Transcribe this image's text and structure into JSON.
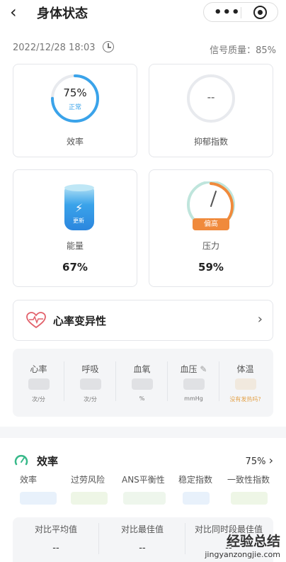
{
  "header": {
    "back_icon": "back-arrow-icon",
    "title": "身体状态",
    "more_icon": "more-dots-icon",
    "target_icon": "target-icon"
  },
  "meta": {
    "datetime": "2022/12/28 18:03",
    "clock_icon": "clock-icon",
    "signal": "信号质量：85%"
  },
  "cards": {
    "efficiency": {
      "value": "75%",
      "status": "正常",
      "label": "效率",
      "progress": 0.75,
      "color": "#3aa3ea"
    },
    "depression": {
      "value": "--",
      "label": "抑郁指数"
    },
    "energy": {
      "badge": "更新",
      "label": "能量",
      "value": "67%",
      "icon": "battery-icon"
    },
    "pressure": {
      "badge": "偏高",
      "label": "压力",
      "value": "59%",
      "color": "#f08a3c"
    }
  },
  "hrv": {
    "label": "心率变异性",
    "heart_icon": "heart-icon",
    "chevron_icon": "chevron-right-icon"
  },
  "vitals": {
    "items": [
      {
        "label": "心率",
        "unit": "次/分"
      },
      {
        "label": "呼吸",
        "unit": "次/分"
      },
      {
        "label": "血氧",
        "unit": "%"
      },
      {
        "label": "血压",
        "unit": "mmHg",
        "icon": "edit-icon"
      },
      {
        "label": "体温",
        "unit": "没有发热吗?"
      }
    ]
  },
  "efficiency_section": {
    "title": "效率",
    "value": "75%",
    "icon": "gauge-icon",
    "subs": [
      "效率",
      "过劳风险",
      "ANS平衡性",
      "稳定指数",
      "一致性指数"
    ],
    "compare": [
      {
        "label": "对比平均值",
        "value": "--"
      },
      {
        "label": "对比最佳值",
        "value": "--"
      },
      {
        "label": "对比同时段最佳值",
        "value": "--"
      }
    ]
  },
  "watermark": {
    "cn": "经验总结",
    "en": "jingyanzongjie.com"
  }
}
